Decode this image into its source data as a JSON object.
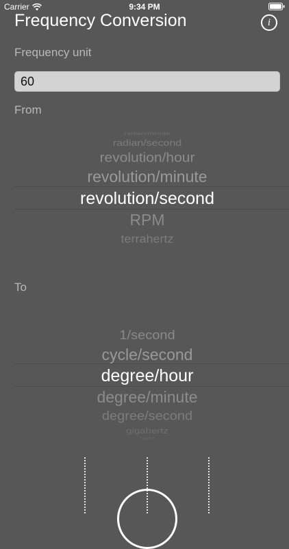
{
  "status_bar": {
    "carrier": "Carrier",
    "time": "9:34 PM",
    "wifi_icon": "wifi-icon",
    "battery_icon": "battery-icon"
  },
  "header": {
    "title": "Frequency Conversion",
    "info_icon": "info-icon",
    "info_glyph": "i"
  },
  "frequency": {
    "label": "Frequency unit",
    "value": "60"
  },
  "from_picker": {
    "label": "From",
    "items": [
      "radian/minute",
      "radian/second",
      "revolution/hour",
      "revolution/minute",
      "revolution/second",
      "RPM",
      "terrahertz"
    ],
    "selected": "revolution/second"
  },
  "to_picker": {
    "label": "To",
    "items": [
      "1/second",
      "cycle/second",
      "degree/hour",
      "degree/minute",
      "degree/second",
      "gigahertz",
      "hertz"
    ],
    "selected": "degree/hour"
  },
  "colors": {
    "background": "#575757",
    "input_background": "#d3d3d3",
    "label": "#b9b9b9",
    "selected_text": "#ffffff"
  }
}
